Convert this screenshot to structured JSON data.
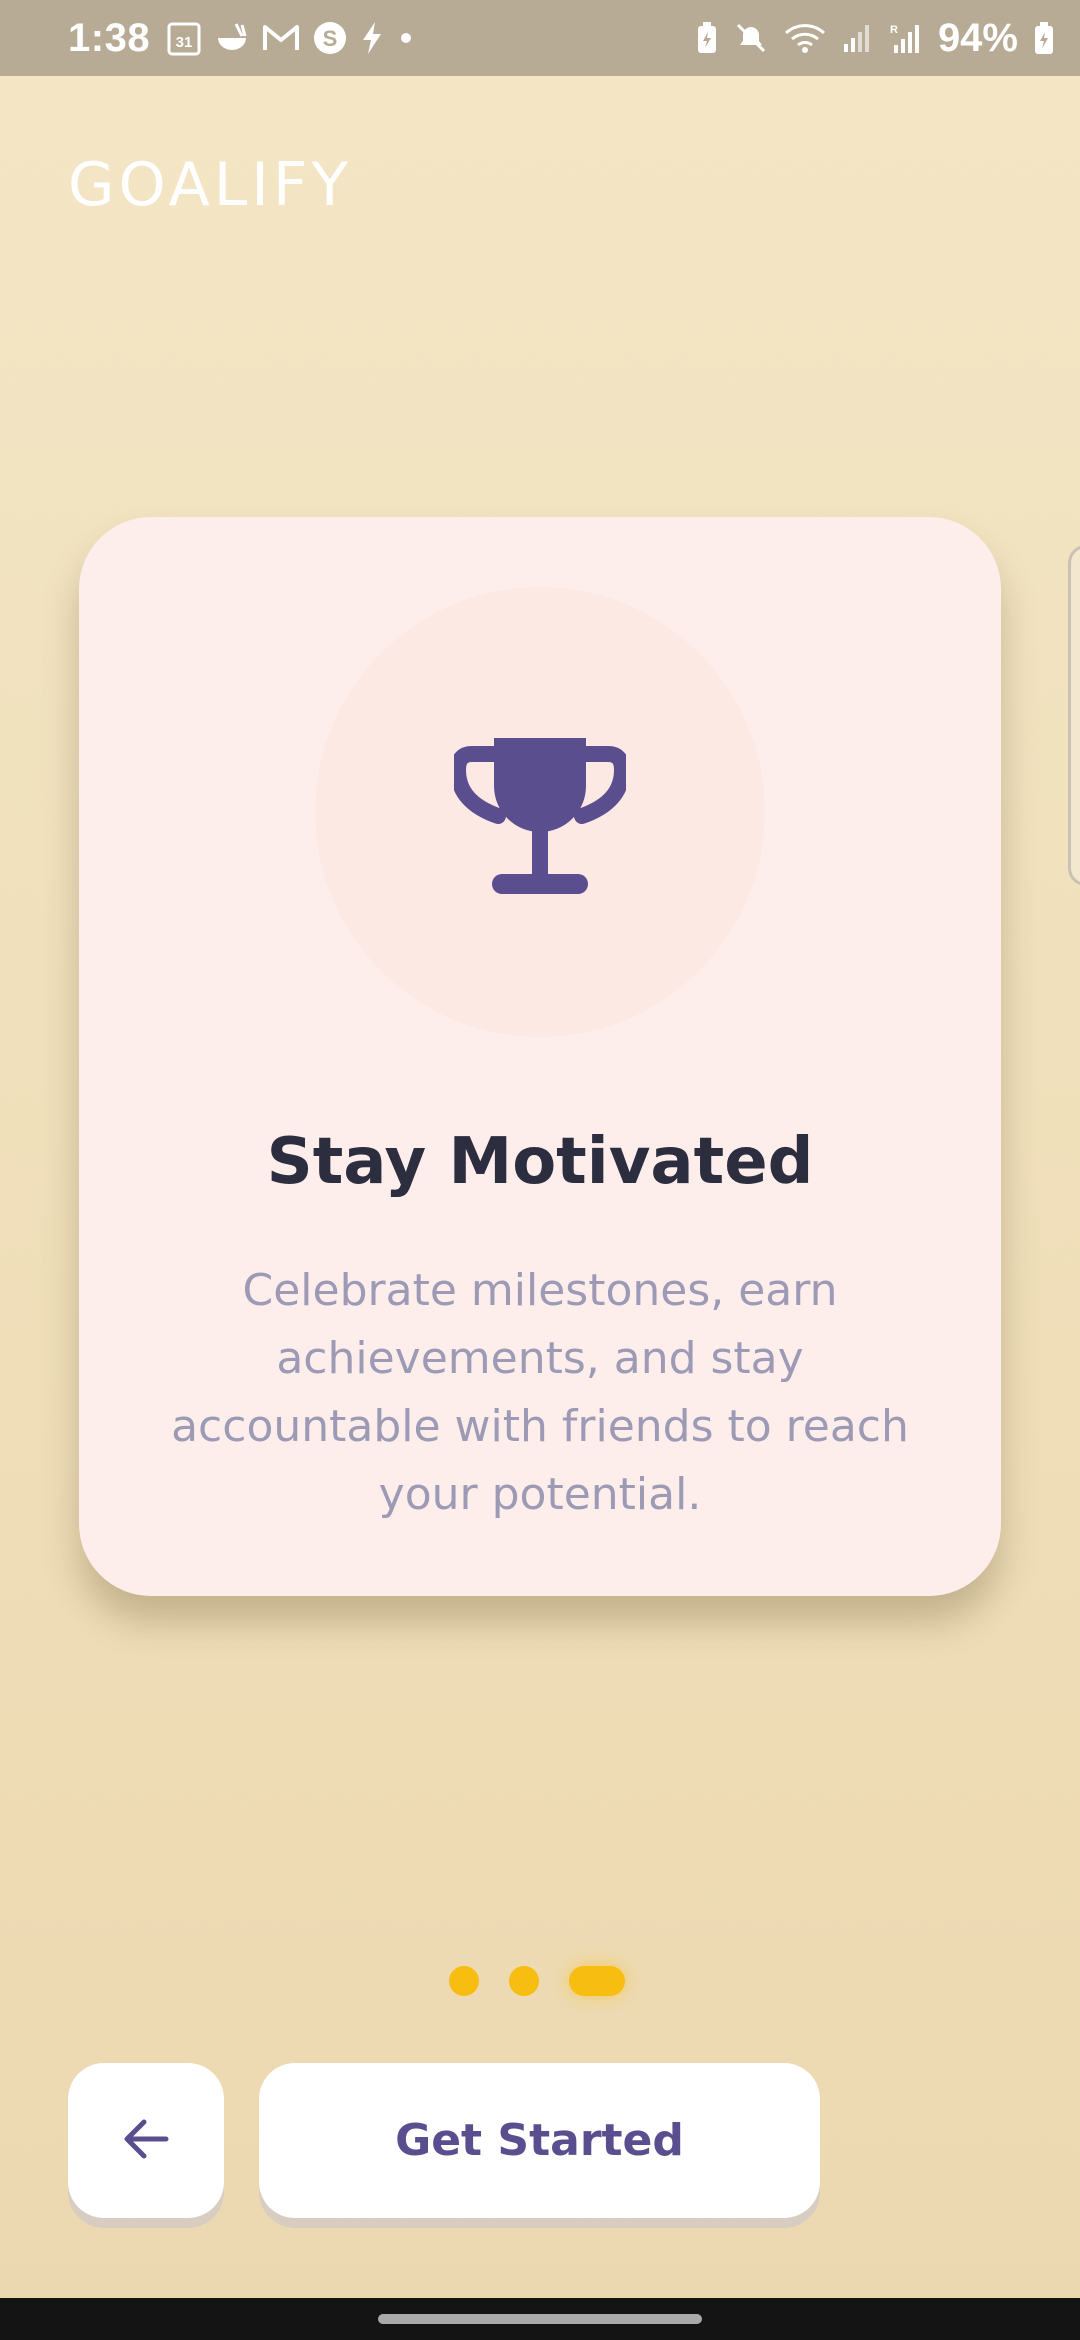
{
  "status_bar": {
    "time": "1:38",
    "calendar_day": "31",
    "battery_percent": "94%",
    "left_icons": [
      "calendar-icon",
      "noodle-bowl-icon",
      "gmail-icon",
      "s-app-icon",
      "flash-icon",
      "dot-icon"
    ],
    "right_icons": [
      "battery-saver-icon",
      "mute-icon",
      "wifi-icon",
      "signal-icon",
      "signal-roaming-icon",
      "battery-icon"
    ]
  },
  "app": {
    "title": "GOALIFY"
  },
  "card": {
    "icon": "trophy-icon",
    "title": "Stay Motivated",
    "description": "Celebrate milestones, earn achievements, and stay accountable with friends to reach your potential."
  },
  "pager": {
    "total": 3,
    "active_index": 3
  },
  "buttons": {
    "back_icon": "arrow-left-icon",
    "get_started_label": "Get Started"
  },
  "colors": {
    "accent_dot": "#f7bd10",
    "primary_purple": "#5b4e8f",
    "title_text": "#2c2d3f",
    "body_text": "#9c9ab4",
    "card_bg": "#fdeeec"
  }
}
